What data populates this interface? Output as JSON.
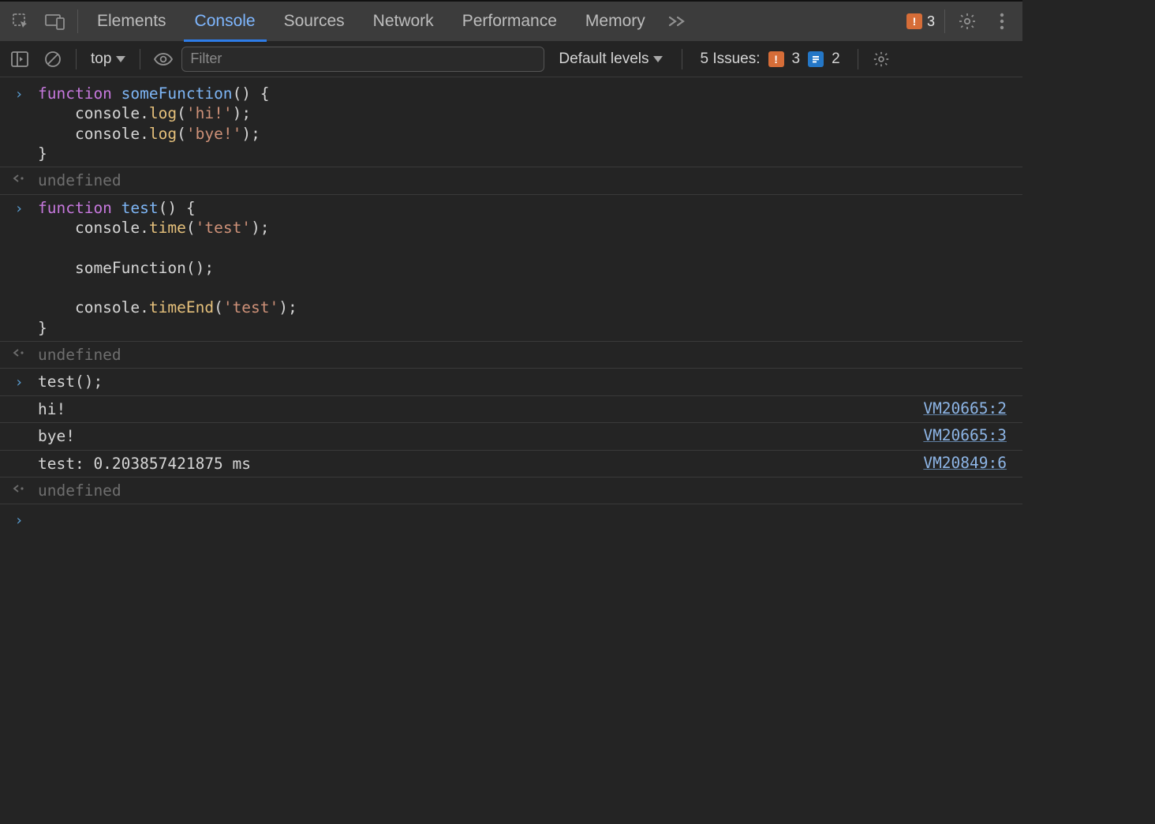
{
  "tabbar": {
    "tabs": [
      {
        "label": "Elements",
        "active": false
      },
      {
        "label": "Console",
        "active": true
      },
      {
        "label": "Sources",
        "active": false
      },
      {
        "label": "Network",
        "active": false
      },
      {
        "label": "Performance",
        "active": false
      },
      {
        "label": "Memory",
        "active": false
      }
    ],
    "error_count": "3"
  },
  "toolbar": {
    "context": "top",
    "filter_placeholder": "Filter",
    "levels_label": "Default levels",
    "issues_label": "5 Issues:",
    "issues_err": "3",
    "issues_info": "2"
  },
  "rows": [
    {
      "type": "input",
      "tokens": [
        {
          "t": "kw",
          "v": "function"
        },
        {
          "t": "plain",
          "v": " "
        },
        {
          "t": "fn",
          "v": "someFunction"
        },
        {
          "t": "plain",
          "v": "() {"
        },
        {
          "t": "nl"
        },
        {
          "t": "plain",
          "v": "    console."
        },
        {
          "t": "mth",
          "v": "log"
        },
        {
          "t": "plain",
          "v": "("
        },
        {
          "t": "str",
          "v": "'hi!'"
        },
        {
          "t": "plain",
          "v": ");"
        },
        {
          "t": "nl"
        },
        {
          "t": "plain",
          "v": "    console."
        },
        {
          "t": "mth",
          "v": "log"
        },
        {
          "t": "plain",
          "v": "("
        },
        {
          "t": "str",
          "v": "'bye!'"
        },
        {
          "t": "plain",
          "v": ");"
        },
        {
          "t": "nl"
        },
        {
          "t": "plain",
          "v": "}"
        }
      ]
    },
    {
      "type": "result",
      "text": "undefined"
    },
    {
      "type": "input",
      "tokens": [
        {
          "t": "kw",
          "v": "function"
        },
        {
          "t": "plain",
          "v": " "
        },
        {
          "t": "fn",
          "v": "test"
        },
        {
          "t": "plain",
          "v": "() {"
        },
        {
          "t": "nl"
        },
        {
          "t": "plain",
          "v": "    console."
        },
        {
          "t": "mth",
          "v": "time"
        },
        {
          "t": "plain",
          "v": "("
        },
        {
          "t": "str",
          "v": "'test'"
        },
        {
          "t": "plain",
          "v": ");"
        },
        {
          "t": "nl"
        },
        {
          "t": "nl"
        },
        {
          "t": "plain",
          "v": "    someFunction();"
        },
        {
          "t": "nl"
        },
        {
          "t": "nl"
        },
        {
          "t": "plain",
          "v": "    console."
        },
        {
          "t": "mth",
          "v": "timeEnd"
        },
        {
          "t": "plain",
          "v": "("
        },
        {
          "t": "str",
          "v": "'test'"
        },
        {
          "t": "plain",
          "v": ");"
        },
        {
          "t": "nl"
        },
        {
          "t": "plain",
          "v": "}"
        }
      ]
    },
    {
      "type": "result",
      "text": "undefined"
    },
    {
      "type": "input",
      "tokens": [
        {
          "t": "plain",
          "v": "test();"
        }
      ]
    },
    {
      "type": "log",
      "text": "hi!",
      "source": "VM20665:2"
    },
    {
      "type": "log",
      "text": "bye!",
      "source": "VM20665:3"
    },
    {
      "type": "log",
      "text": "test: 0.203857421875 ms",
      "source": "VM20849:6"
    },
    {
      "type": "result",
      "text": "undefined"
    }
  ]
}
